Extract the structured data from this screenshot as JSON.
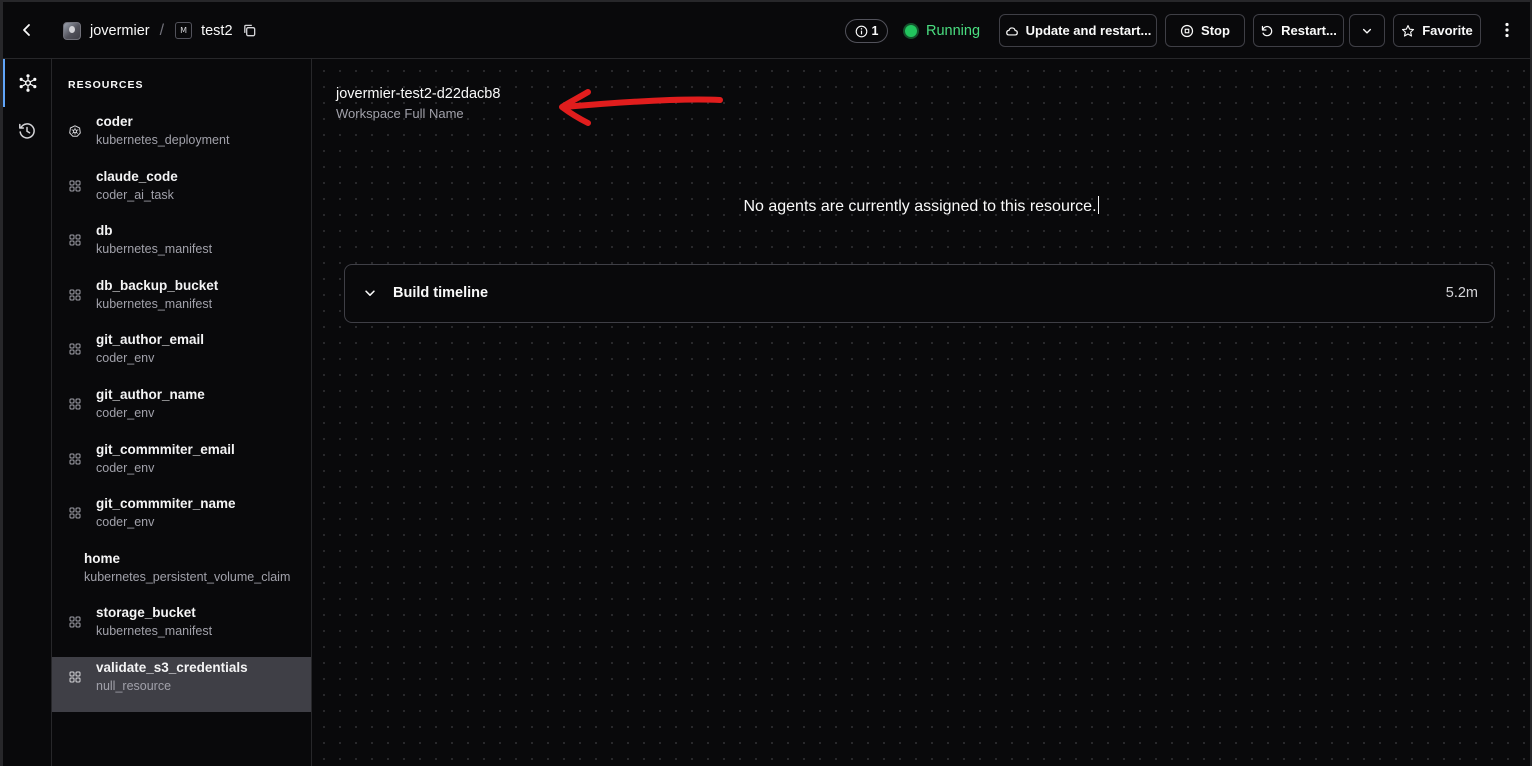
{
  "header": {
    "owner": "jovermier",
    "separator": "/",
    "template_initial": "M",
    "workspace": "test2",
    "notifications_count": "1",
    "status": "Running",
    "buttons": {
      "update": "Update and restart...",
      "stop": "Stop",
      "restart": "Restart...",
      "favorite": "Favorite"
    },
    "colors": {
      "status": "#22c55e",
      "accent": "#60a5fa"
    }
  },
  "rail": {
    "items": [
      {
        "icon": "resources-graph-icon",
        "active": true
      },
      {
        "icon": "history-icon",
        "active": false
      }
    ]
  },
  "sidebar": {
    "title": "RESOURCES",
    "items": [
      {
        "name": "coder",
        "type": "kubernetes_deployment",
        "icon": "kubernetes-icon"
      },
      {
        "name": "claude_code",
        "type": "coder_ai_task",
        "icon": "widget-icon"
      },
      {
        "name": "db",
        "type": "kubernetes_manifest",
        "icon": "widget-icon"
      },
      {
        "name": "db_backup_bucket",
        "type": "kubernetes_manifest",
        "icon": "widget-icon"
      },
      {
        "name": "git_author_email",
        "type": "coder_env",
        "icon": "widget-icon"
      },
      {
        "name": "git_author_name",
        "type": "coder_env",
        "icon": "widget-icon"
      },
      {
        "name": "git_commmiter_email",
        "type": "coder_env",
        "icon": "widget-icon"
      },
      {
        "name": "git_commmiter_name",
        "type": "coder_env",
        "icon": "widget-icon"
      },
      {
        "name": "home",
        "type": "kubernetes_persistent_volume_claim",
        "icon": ""
      },
      {
        "name": "storage_bucket",
        "type": "kubernetes_manifest",
        "icon": "widget-icon"
      },
      {
        "name": "validate_s3_credentials",
        "type": "null_resource",
        "icon": "widget-icon",
        "selected": true
      }
    ]
  },
  "main": {
    "workspace_full_name": "jovermier-test2-d22dacb8",
    "workspace_full_name_label": "Workspace Full Name",
    "no_agents_message": "No agents are currently assigned to this resource.",
    "timeline": {
      "title": "Build timeline",
      "duration": "5.2m"
    }
  }
}
